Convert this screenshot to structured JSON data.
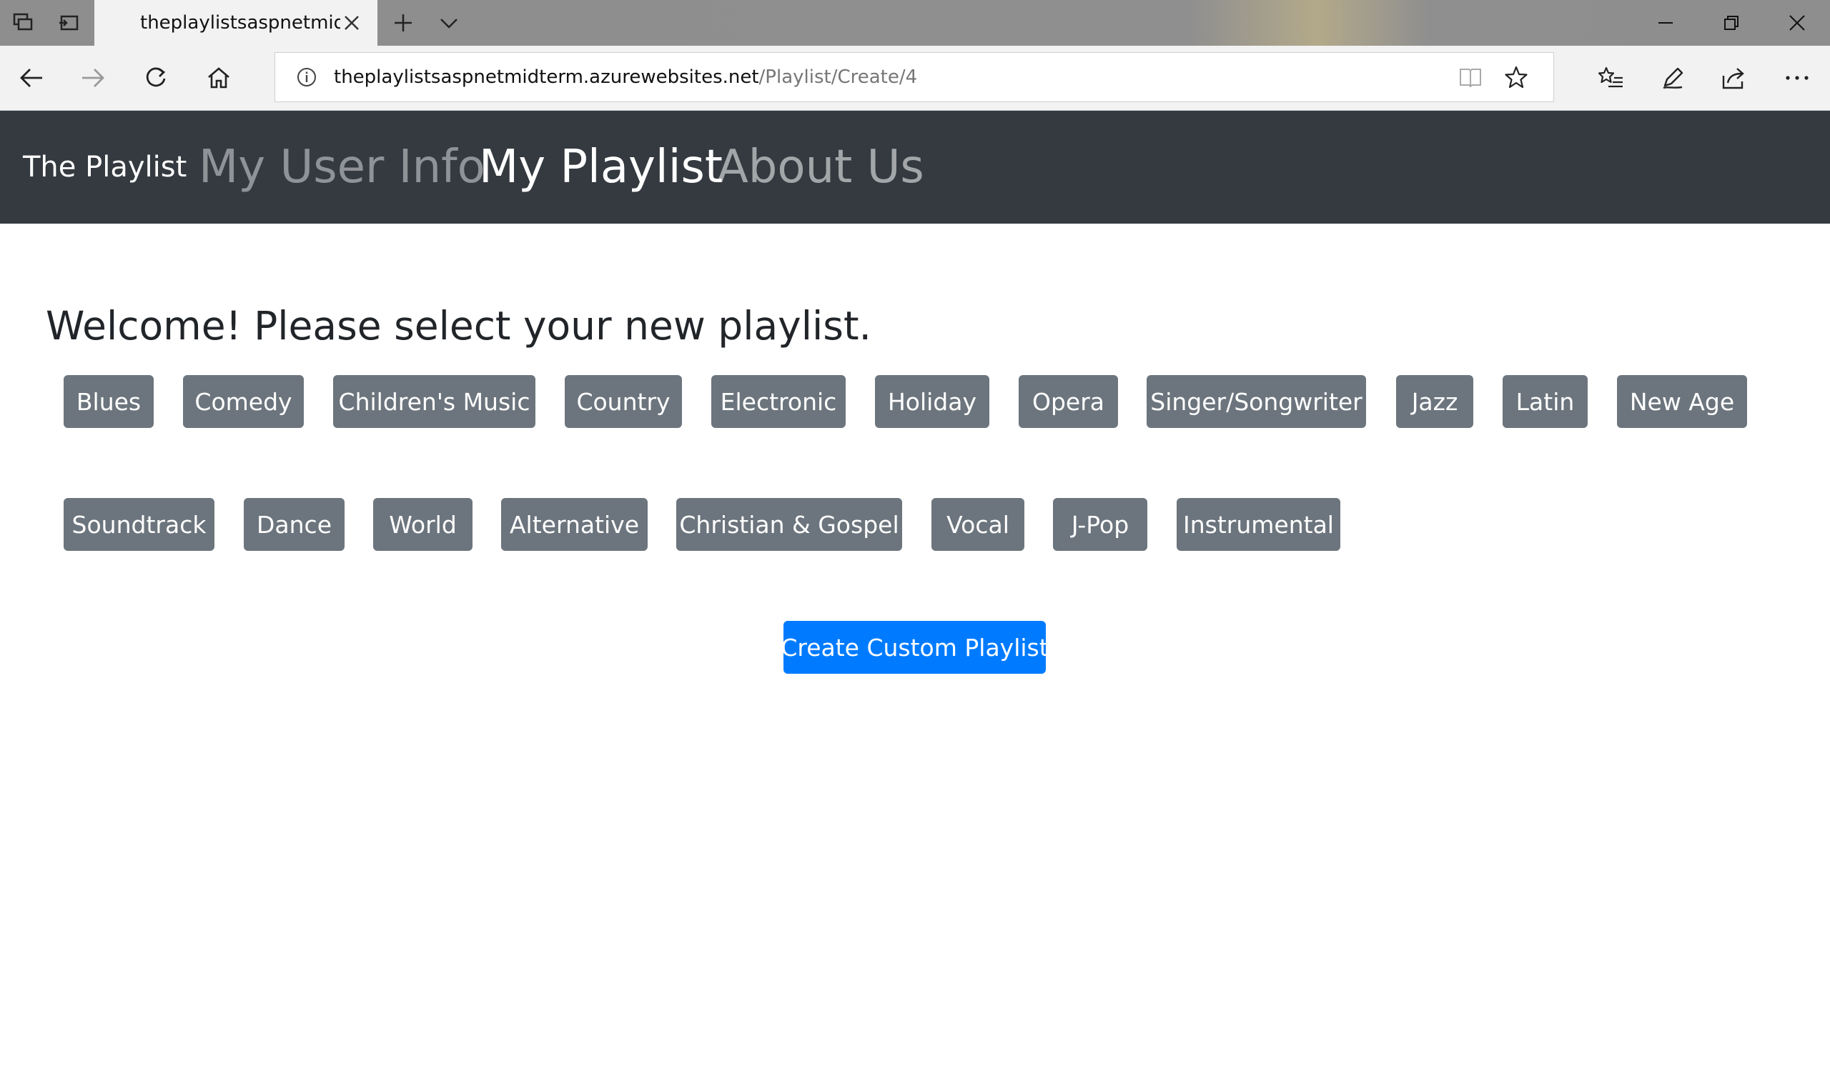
{
  "browser": {
    "tab_title": "theplaylistsaspnetmidte",
    "address_host": "theplaylistsaspnetmidterm.azurewebsites.net",
    "address_path": "/Playlist/Create/4",
    "icons": {
      "tab_actions": "tab-actions-icon",
      "set_aside": "set-aside-tabs-icon",
      "new_tab": "plus-icon",
      "tab_preview": "chevron-down-icon",
      "close_tab": "close-icon",
      "minimize": "minimize-icon",
      "restore": "restore-icon",
      "close_window": "close-icon",
      "back": "back-arrow-icon",
      "forward": "forward-arrow-icon",
      "refresh": "refresh-icon",
      "home": "home-icon",
      "site_info": "info-icon",
      "reading_view": "reading-view-icon",
      "favorite": "star-icon",
      "favorites_hub": "favorites-list-icon",
      "notes": "pen-icon",
      "share": "share-icon",
      "more": "more-icon"
    }
  },
  "site": {
    "brand": "The Playlist",
    "nav_links": [
      "My User Info",
      "My Playlist",
      "About Us"
    ],
    "active_link": "My Playlist"
  },
  "main": {
    "heading": "Welcome! Please select your new playlist.",
    "genres_row1": [
      "Blues",
      "Comedy",
      "Children's Music",
      "Country",
      "Electronic",
      "Holiday",
      "Opera",
      "Singer/Songwriter",
      "Jazz",
      "Latin",
      "New Age"
    ],
    "genres_row2": [
      "Soundtrack",
      "Dance",
      "World",
      "Alternative",
      "Christian & Gospel",
      "Vocal",
      "J-Pop",
      "Instrumental"
    ],
    "create_button": "Create Custom Playlist"
  },
  "colors": {
    "navbar_bg": "#343a40",
    "genre_button_bg": "#6c757d",
    "primary_button_bg": "#007bff",
    "chrome_bg": "#f2f2f2"
  }
}
